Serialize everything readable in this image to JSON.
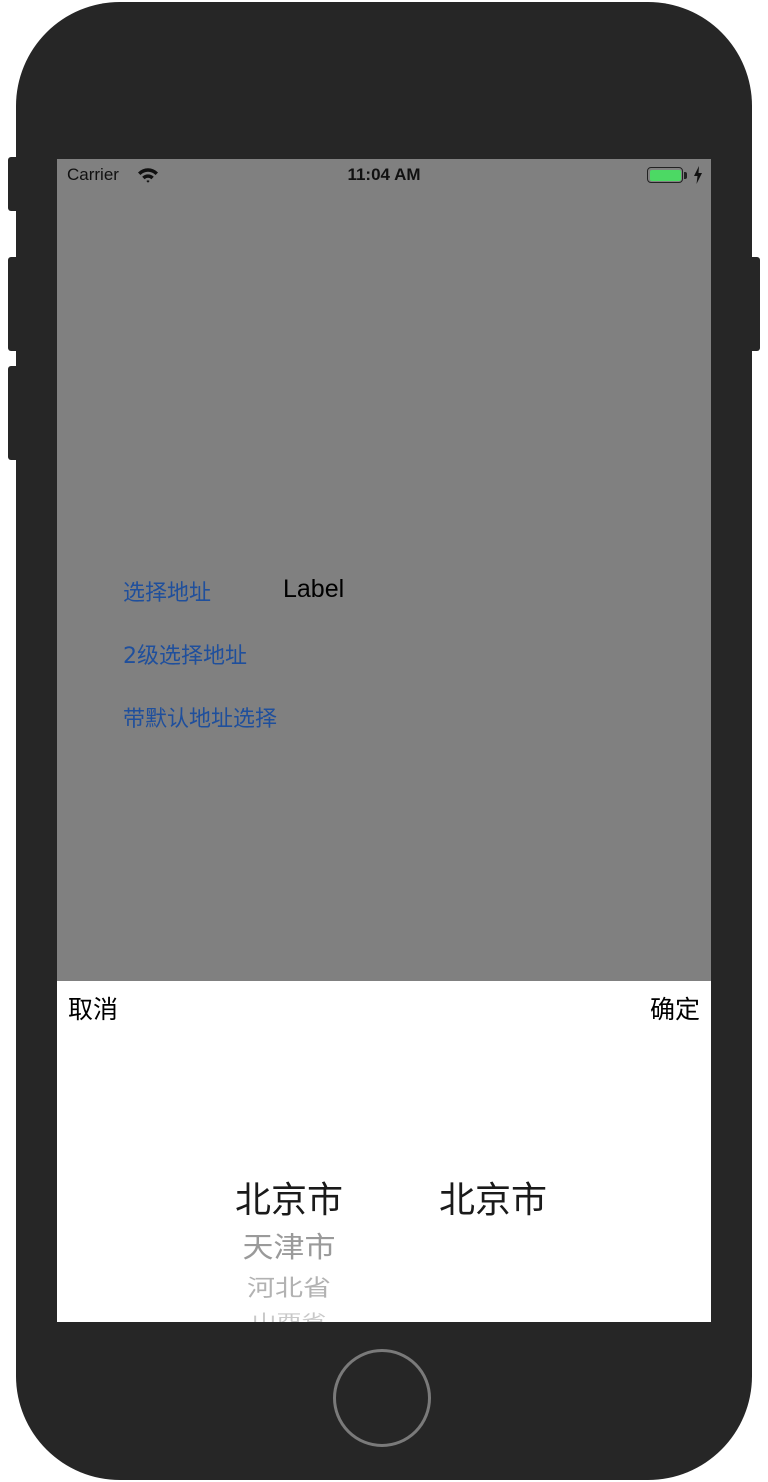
{
  "status_bar": {
    "carrier": "Carrier",
    "time": "11:04 AM",
    "battery_color": "#4cd964"
  },
  "main": {
    "buttons": [
      {
        "label": "选择地址"
      },
      {
        "label": "2级选择地址"
      },
      {
        "label": "带默认地址选择"
      }
    ],
    "result_label": "Label",
    "link_color": "#1f4f9c",
    "background_color": "#808080"
  },
  "picker": {
    "cancel_label": "取消",
    "confirm_label": "确定",
    "province_column": [
      "北京市",
      "天津市",
      "河北省",
      "山西省"
    ],
    "city_column": [
      "北京市"
    ]
  },
  "icons": {
    "wifi": "wifi-icon",
    "battery": "battery-icon",
    "charging": "charging-bolt-icon",
    "home": "home-button"
  }
}
